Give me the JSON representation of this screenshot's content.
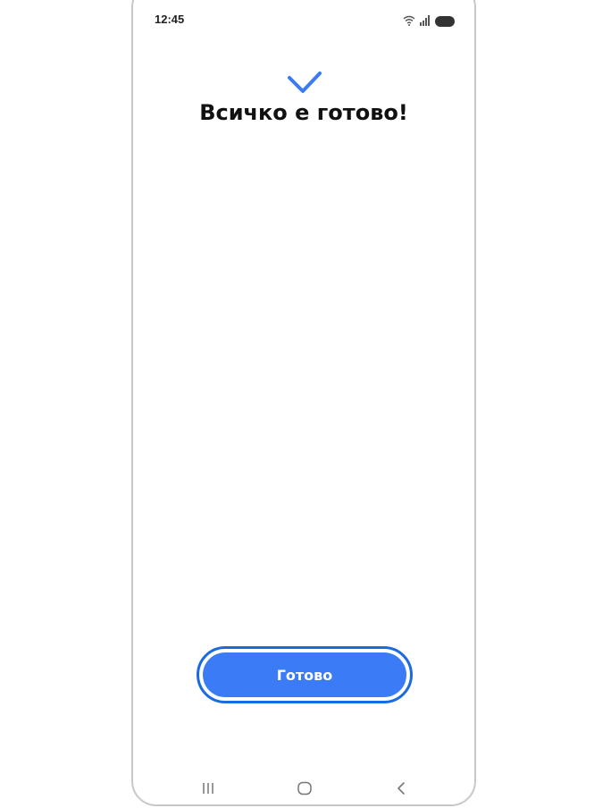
{
  "status_bar": {
    "time": "12:45",
    "icons": [
      "wifi-icon",
      "signal-icon",
      "battery-icon"
    ]
  },
  "main": {
    "check_icon": "checkmark-icon",
    "title": "Всичко е готово!"
  },
  "actions": {
    "done_label": "Готово"
  },
  "nav_bar": {
    "items": [
      "recents-icon",
      "home-icon",
      "back-icon"
    ]
  },
  "colors": {
    "accent": "#3b7cf6",
    "focus_outline": "#1a6ae0",
    "check": "#3b7cf6"
  }
}
